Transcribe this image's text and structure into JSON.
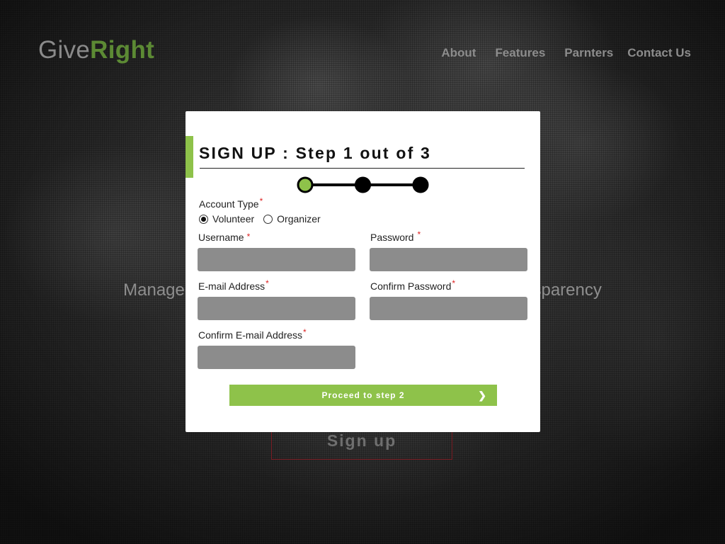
{
  "brand": {
    "part1": "Give",
    "part2": "Right"
  },
  "nav": {
    "items": [
      "About",
      "Features",
      "Parnters",
      "Contact Us"
    ]
  },
  "hero": {
    "tagline": "Manage nonprofit volunteering with ease and full transparency",
    "signup_label": "Sign up"
  },
  "modal": {
    "title": "SIGN UP : Step 1 out of 3",
    "stepper": {
      "total_steps": 3,
      "current_step": 1
    },
    "account_type": {
      "label": "Account Type",
      "options": [
        "Volunteer",
        "Organizer"
      ],
      "selected": "Volunteer"
    },
    "fields": {
      "username": {
        "label": "Username",
        "value": ""
      },
      "password": {
        "label": "Password",
        "value": ""
      },
      "email": {
        "label": "E-mail Address",
        "value": ""
      },
      "confirm_password": {
        "label": "Confirm Password",
        "value": ""
      },
      "confirm_email": {
        "label": "Confirm E-mail Address",
        "value": ""
      }
    },
    "required_mark": "*",
    "proceed_label": "Proceed to step 2",
    "proceed_icon": "❯"
  },
  "colors": {
    "accent_green": "#8ec24a",
    "brand_green": "#5c8a34",
    "required_red": "#dd2222",
    "input_gray": "#8c8c8c"
  },
  "icons": {
    "proceed": "chevron-right-icon",
    "step": "step-dot-icon"
  }
}
